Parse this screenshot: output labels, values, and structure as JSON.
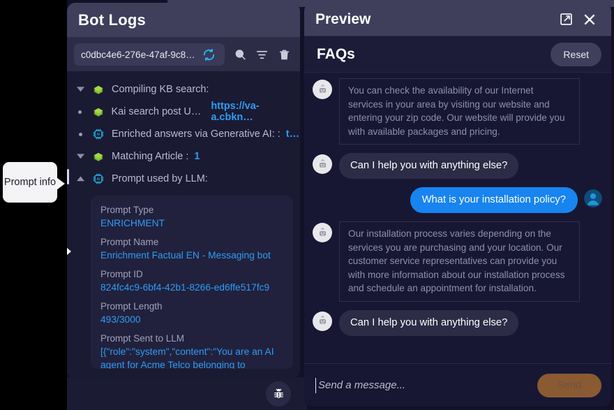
{
  "bot_logs": {
    "title": "Bot Logs",
    "session_id": "c0dbc4e6-276e-47af-9c8d-...",
    "toolbar": {
      "refresh": "refresh-icon",
      "search": "search-icon",
      "filter": "filter-icon",
      "delete": "trash-icon"
    },
    "tree": [
      {
        "marker": "caret-down",
        "icon": "kb-books-icon",
        "label": "Compiling KB search:",
        "value": "",
        "value_kind": "none"
      },
      {
        "marker": "bullet",
        "icon": "kb-books-icon",
        "label": "Kai search post URL: ",
        "value": "https://va-a.cbkn…",
        "value_kind": "link"
      },
      {
        "marker": "bullet",
        "icon": "ai-chip-icon",
        "label": "Enriched answers via Generative AI: : ",
        "value": "t…",
        "value_kind": "link"
      },
      {
        "marker": "caret-down",
        "icon": "kb-books-icon",
        "label": "Matching Article : ",
        "value": "1",
        "value_kind": "number"
      },
      {
        "marker": "caret-up",
        "icon": "ai-chip-icon",
        "label": "Prompt used by LLM:",
        "value": "",
        "value_kind": "none"
      }
    ],
    "prompt_details": [
      {
        "label": "Prompt Type",
        "value": "ENRICHMENT"
      },
      {
        "label": "Prompt Name",
        "value": "Enrichment Factual EN - Messaging bot"
      },
      {
        "label": "Prompt ID",
        "value": "824fc4c9-6bf4-42b1-8266-ed6ffe517fc9"
      },
      {
        "label": "Prompt Length",
        "value": "493/3000"
      },
      {
        "label": "Prompt Sent to LLM",
        "value": "[{\"role\":\"system\",\"content\":\"You are an AI agent for Acme Telco belonging to Telecommunications. You strictly follow your instructions. For every user message"
      }
    ]
  },
  "tooltip": {
    "text": "Prompt info"
  },
  "preview": {
    "title": "Preview",
    "expand_icon": "expand-icon",
    "close_icon": "close-icon",
    "faq_title": "FAQs",
    "reset_label": "Reset",
    "messages": [
      {
        "role": "bot",
        "style": "card",
        "text": "You can check the availability of our Internet services in your area by visiting our website and entering your zip code. Our website will provide you with available packages and pricing."
      },
      {
        "role": "bot",
        "style": "bubble",
        "text": "Can I help you with anything else?"
      },
      {
        "role": "user",
        "style": "bubble",
        "text": "What is your installation policy?"
      },
      {
        "role": "bot",
        "style": "card",
        "text": "Our installation process varies depending on the services you are purchasing and your location. Our customer service representatives can provide you with more information about our installation process and schedule an appointment for installation."
      },
      {
        "role": "bot",
        "style": "bubble",
        "text": "Can I help you with anything else?"
      }
    ],
    "composer": {
      "placeholder": "Send a message...",
      "value": "",
      "send_label": "Send"
    }
  },
  "debug_fab": {
    "icon": "bug-icon"
  },
  "colors": {
    "accent_blue": "#1784f0",
    "link_blue": "#2f9cf4",
    "panel_header": "#3f3f5c",
    "panel_body": "#1a1a33",
    "send_disabled": "#8a5a33"
  }
}
